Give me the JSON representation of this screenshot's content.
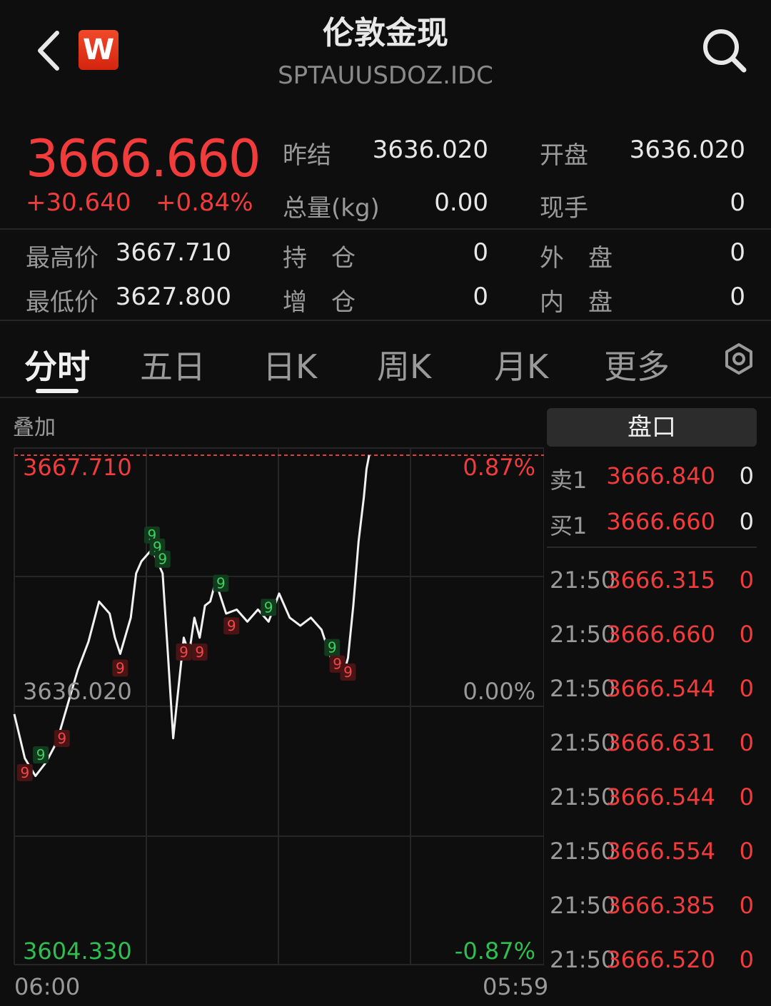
{
  "header": {
    "title": "伦敦金现",
    "subtitle": "SPTAUUSDOZ.IDC",
    "logo_text": "W"
  },
  "quote": {
    "price": "3666.660",
    "change_abs": "+30.640",
    "change_pct": "+0.84%",
    "up_color": "#f23c3c",
    "down_color": "#2fbf4f",
    "stats": {
      "prev_settle_label": "昨结",
      "prev_settle_value": "3636.020",
      "open_label": "开盘",
      "open_value": "3636.020",
      "volume_label": "总量(kg)",
      "volume_value": "0.00",
      "current_hand_label": "现手",
      "current_hand_value": "0",
      "high_label": "最高价",
      "high_value": "3667.710",
      "low_label": "最低价",
      "low_value": "3627.800",
      "position_label": "持　仓",
      "position_value": "0",
      "add_position_label": "增　仓",
      "add_position_value": "0",
      "outer_label": "外　盘",
      "outer_value": "0",
      "inner_label": "内　盘",
      "inner_value": "0"
    }
  },
  "tabs": [
    {
      "label": "分时",
      "active": true
    },
    {
      "label": "五日",
      "active": false
    },
    {
      "label": "日K",
      "active": false
    },
    {
      "label": "周K",
      "active": false
    },
    {
      "label": "月K",
      "active": false
    },
    {
      "label": "更多",
      "active": false
    }
  ],
  "chart": {
    "overlay_label": "叠加",
    "y_top": "3667.710",
    "y_mid": "3636.020",
    "y_bottom": "3604.330",
    "pct_top": "0.87%",
    "pct_mid": "0.00%",
    "pct_bottom": "-0.87%",
    "x_start": "06:00",
    "x_end": "05:59",
    "marker_text": "9"
  },
  "chart_data": {
    "type": "line",
    "ylim": [
      3604.33,
      3667.71
    ],
    "reference": 3636.02,
    "x": [
      0,
      0.02,
      0.04,
      0.06,
      0.08,
      0.1,
      0.12,
      0.14,
      0.16,
      0.18,
      0.19,
      0.2,
      0.22,
      0.23,
      0.24,
      0.26,
      0.28,
      0.29,
      0.3,
      0.32,
      0.33,
      0.34,
      0.35,
      0.36,
      0.37,
      0.38,
      0.4,
      0.42,
      0.44,
      0.46,
      0.48,
      0.5,
      0.52,
      0.54,
      0.56,
      0.58,
      0.6,
      0.61,
      0.62,
      0.63,
      0.64,
      0.65,
      0.66,
      0.665,
      0.67
    ],
    "y": [
      3635.5,
      3630.0,
      3627.8,
      3629.5,
      3632.0,
      3636.5,
      3641.0,
      3644.5,
      3649.5,
      3648.0,
      3645.0,
      3643.0,
      3647.5,
      3653.0,
      3654.5,
      3656.0,
      3653.0,
      3643.0,
      3632.5,
      3645.0,
      3643.0,
      3647.5,
      3645.0,
      3649.0,
      3649.5,
      3652.0,
      3648.0,
      3648.5,
      3647.0,
      3648.5,
      3647.0,
      3650.5,
      3647.5,
      3646.5,
      3647.5,
      3646.0,
      3642.0,
      3643.5,
      3640.0,
      3642.5,
      3649.0,
      3657.0,
      3662.5,
      3666.0,
      3667.7
    ]
  },
  "markers": [
    {
      "type": "sell",
      "label": "9",
      "at": 0.02
    },
    {
      "type": "buy",
      "label": "9",
      "at": 0.05
    },
    {
      "type": "sell",
      "label": "9",
      "at": 0.09
    },
    {
      "type": "sell",
      "label": "9",
      "at": 0.2
    },
    {
      "type": "buy",
      "label": "9",
      "at": 0.26
    },
    {
      "type": "buy",
      "label": "9",
      "at": 0.27
    },
    {
      "type": "buy",
      "label": "9",
      "at": 0.28
    },
    {
      "type": "sell",
      "label": "9",
      "at": 0.32
    },
    {
      "type": "sell",
      "label": "9",
      "at": 0.35
    },
    {
      "type": "buy",
      "label": "9",
      "at": 0.39
    },
    {
      "type": "sell",
      "label": "9",
      "at": 0.41
    },
    {
      "type": "buy",
      "label": "9",
      "at": 0.48
    },
    {
      "type": "buy",
      "label": "9",
      "at": 0.6
    },
    {
      "type": "sell",
      "label": "9",
      "at": 0.61
    },
    {
      "type": "sell",
      "label": "9",
      "at": 0.63
    }
  ],
  "panel": {
    "header": "盘口",
    "book": [
      {
        "label": "卖1",
        "price": "3666.840",
        "vol": "0"
      },
      {
        "label": "买1",
        "price": "3666.660",
        "vol": "0"
      }
    ],
    "trades": [
      {
        "time": "21:50",
        "price": "3666.315",
        "vol": "0"
      },
      {
        "time": "21:50",
        "price": "3666.660",
        "vol": "0"
      },
      {
        "time": "21:50",
        "price": "3666.544",
        "vol": "0"
      },
      {
        "time": "21:50",
        "price": "3666.631",
        "vol": "0"
      },
      {
        "time": "21:50",
        "price": "3666.544",
        "vol": "0"
      },
      {
        "time": "21:50",
        "price": "3666.554",
        "vol": "0"
      },
      {
        "time": "21:50",
        "price": "3666.385",
        "vol": "0"
      },
      {
        "time": "21:50",
        "price": "3666.520",
        "vol": "0"
      }
    ]
  },
  "icons": {
    "back": "chevron-left-icon",
    "search": "search-icon",
    "settings": "hexagon-settings-icon"
  }
}
